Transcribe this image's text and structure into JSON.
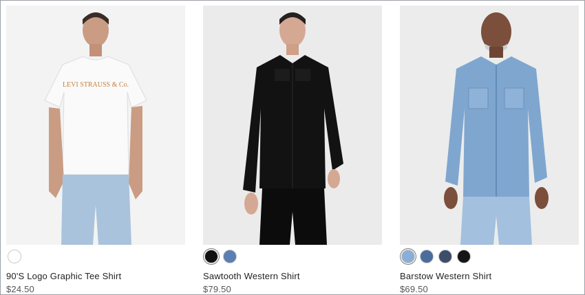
{
  "products": [
    {
      "name": "90'S Logo Graphic Tee Shirt",
      "price": "$24.50",
      "image_bg": "#f3f3f3",
      "tee_text": "LEVI STRAUSS & Co.",
      "swatches": [
        {
          "color": "#ffffff",
          "selected": false
        }
      ]
    },
    {
      "name": "Sawtooth Western Shirt",
      "price": "$79.50",
      "image_bg": "#ebebeb",
      "swatches": [
        {
          "color": "#111111",
          "selected": true
        },
        {
          "color": "#5b7fb0",
          "selected": false
        }
      ]
    },
    {
      "name": "Barstow Western Shirt",
      "price": "$69.50",
      "image_bg": "#ececec",
      "swatches": [
        {
          "color": "#8aaed6",
          "selected": true
        },
        {
          "color": "#4c6d9c",
          "selected": false
        },
        {
          "color": "#3d4d6a",
          "selected": false
        },
        {
          "color": "#151515",
          "selected": false
        }
      ]
    }
  ]
}
